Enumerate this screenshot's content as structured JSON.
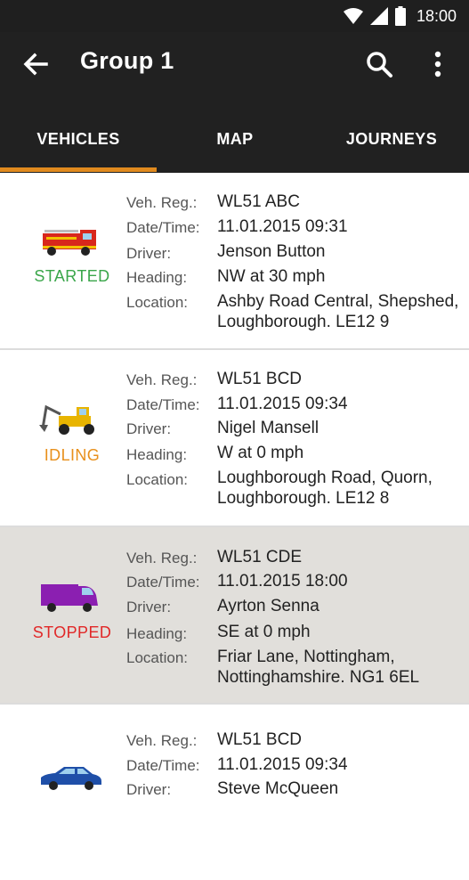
{
  "status_bar": {
    "time": "18:00"
  },
  "toolbar": {
    "title": "Group 1"
  },
  "tabs": [
    {
      "label": "VEHICLES"
    },
    {
      "label": "MAP"
    },
    {
      "label": "JOURNEYS"
    }
  ],
  "labels": {
    "reg": "Veh. Reg.:",
    "datetime": "Date/Time:",
    "driver": "Driver:",
    "heading": "Heading:",
    "location": "Location:"
  },
  "vehicles": [
    {
      "icon": "fire-engine-icon",
      "status": "STARTED",
      "status_color": "#3aa64a",
      "reg": "WL51 ABC",
      "datetime": "11.01.2015  09:31",
      "driver": "Jenson Button",
      "heading": "NW at 30 mph",
      "location_line1": "Ashby Road Central, Shepshed,",
      "location_line2": "Loughborough. LE12 9"
    },
    {
      "icon": "digger-icon",
      "status": "IDLING",
      "status_color": "#e8901c",
      "reg": "WL51 BCD",
      "datetime": "11.01.2015  09:34",
      "driver": "Nigel Mansell",
      "heading": "W at 0 mph",
      "location_line1": "Loughborough Road, Quorn,",
      "location_line2": "Loughborough. LE12 8"
    },
    {
      "icon": "van-icon",
      "status": "STOPPED",
      "status_color": "#e12828",
      "reg": "WL51 CDE",
      "datetime": "11.01.2015  18:00",
      "driver": "Ayrton Senna",
      "heading": "SE at 0 mph",
      "location_line1": "Friar Lane, Nottingham,",
      "location_line2": "Nottinghamshire. NG1 6EL"
    },
    {
      "icon": "car-icon",
      "reg": "WL51 BCD",
      "datetime": "11.01.2015  09:34",
      "driver": "Steve McQueen"
    }
  ]
}
